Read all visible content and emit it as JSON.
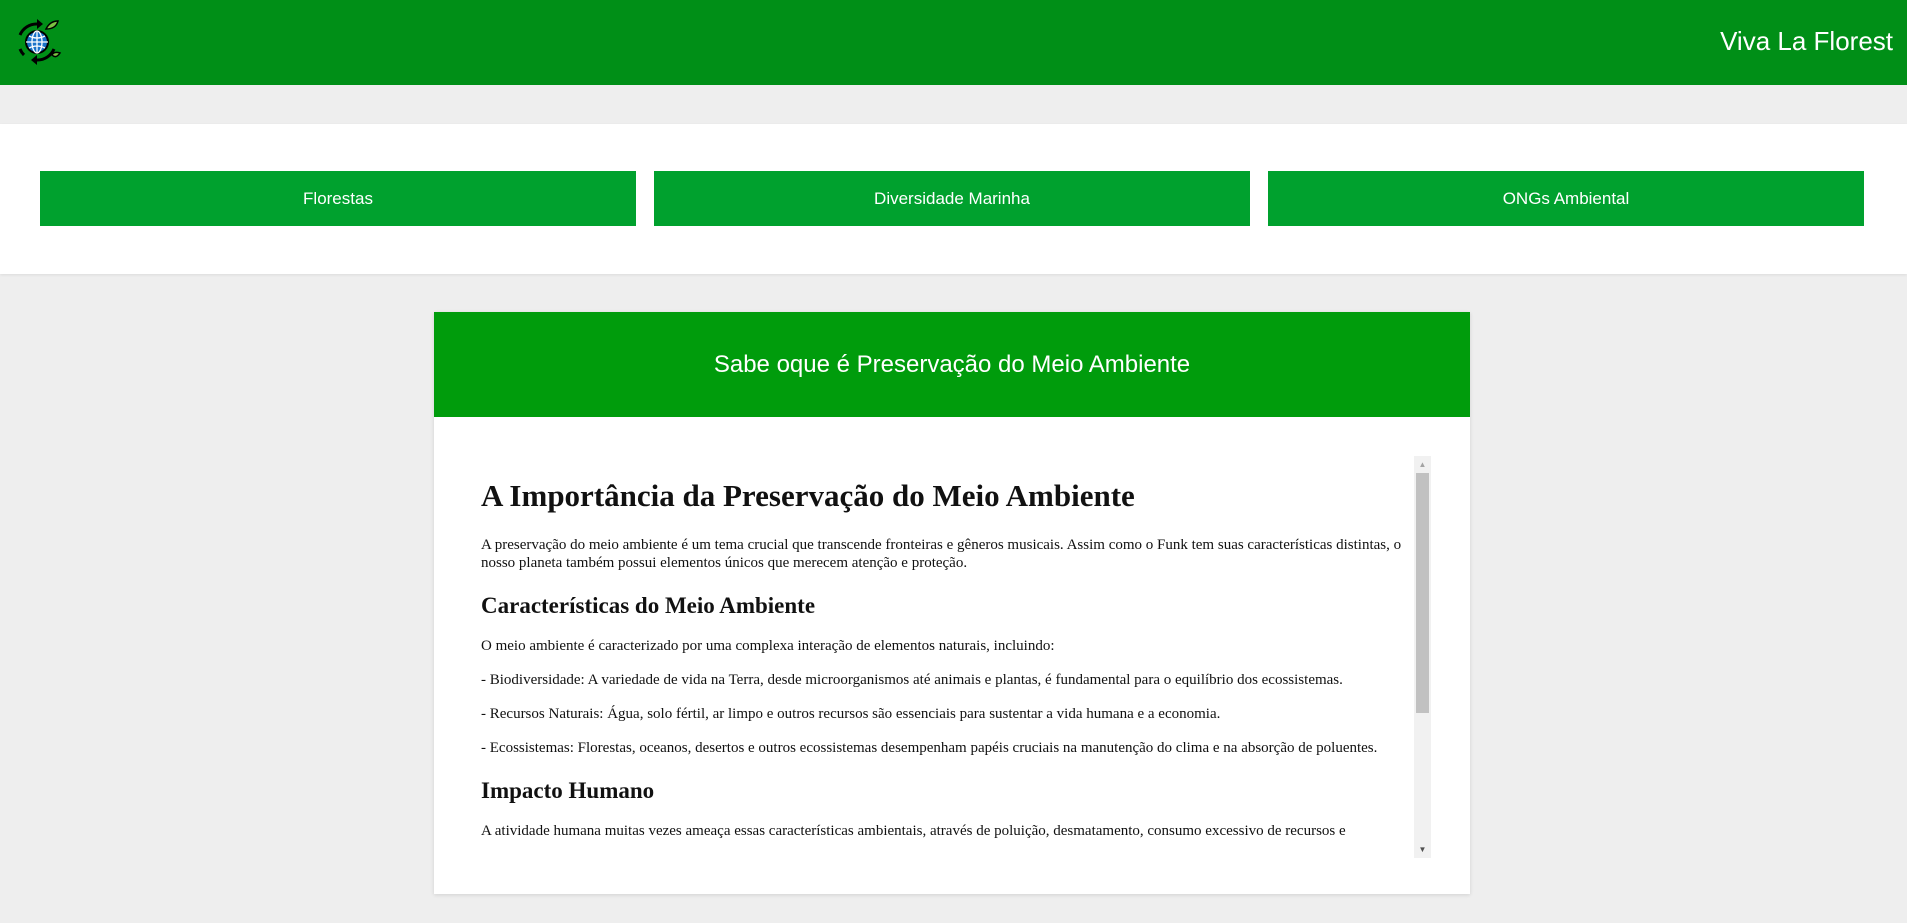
{
  "header": {
    "brand": "Viva La Florest",
    "logo_icon": "recycle-globe-icon",
    "accent_color": "#008f17"
  },
  "nav": {
    "items": [
      {
        "label": "Florestas"
      },
      {
        "label": "Diversidade Marinha"
      },
      {
        "label": "ONGs Ambiental"
      }
    ],
    "button_color": "#00a12e"
  },
  "card": {
    "title": "Sabe oque é Preservação do Meio Ambiente",
    "header_color": "#009c0c"
  },
  "article": {
    "heading": "A Importância da Preservação do Meio Ambiente",
    "intro": "A preservação do meio ambiente é um tema crucial que transcende fronteiras e gêneros musicais. Assim como o Funk tem suas características distintas, o nosso planeta também possui elementos únicos que merecem atenção e proteção.",
    "section1_heading": "Características do Meio Ambiente",
    "section1_intro": "O meio ambiente é caracterizado por uma complexa interação de elementos naturais, incluindo:",
    "bullets": [
      "- Biodiversidade: A variedade de vida na Terra, desde microorganismos até animais e plantas, é fundamental para o equilíbrio dos ecossistemas.",
      "- Recursos Naturais: Água, solo fértil, ar limpo e outros recursos são essenciais para sustentar a vida humana e a economia.",
      "- Ecossistemas: Florestas, oceanos, desertos e outros ecossistemas desempenham papéis cruciais na manutenção do clima e na absorção de poluentes."
    ],
    "section2_heading": "Impacto Humano",
    "section2_text": "A atividade humana muitas vezes ameaça essas características ambientais, através de poluição, desmatamento, consumo excessivo de recursos e"
  }
}
